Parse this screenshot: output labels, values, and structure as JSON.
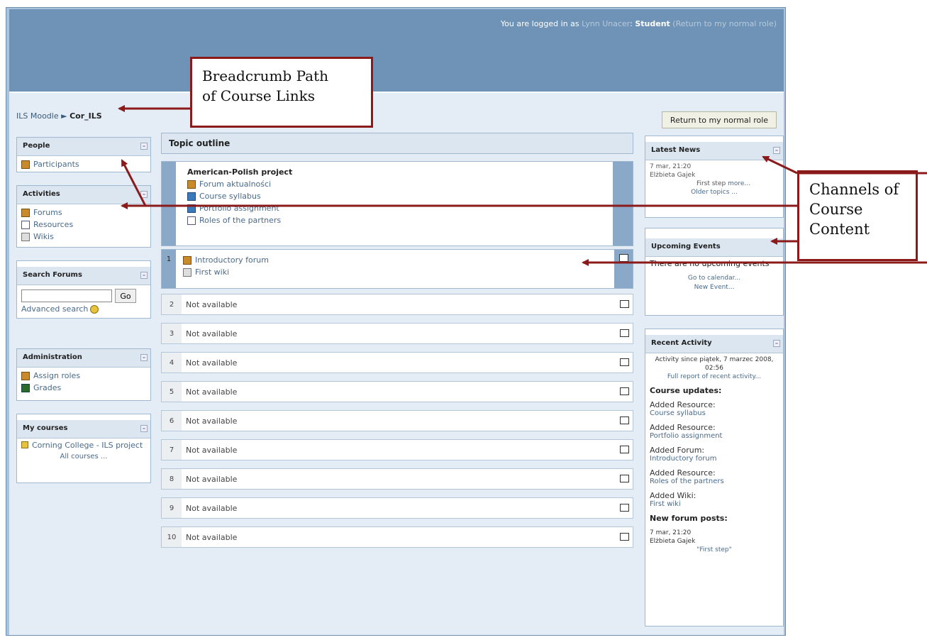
{
  "header": {
    "login_prefix": "You are logged in as",
    "user": "Lynn Unacer",
    "role": "Student",
    "return_link": "(Return to my normal role)"
  },
  "breadcrumb": {
    "home": "ILS Moodle",
    "sep": "►",
    "course": "Cor_ILS"
  },
  "return_button": "Return to my normal role",
  "left": {
    "people": {
      "title": "People",
      "items": [
        "Participants"
      ]
    },
    "activities": {
      "title": "Activities",
      "items": [
        "Forums",
        "Resources",
        "Wikis"
      ]
    },
    "search": {
      "title": "Search Forums",
      "go": "Go",
      "advanced": "Advanced search"
    },
    "admin": {
      "title": "Administration",
      "items": [
        "Assign roles",
        "Grades"
      ]
    },
    "courses": {
      "title": "My courses",
      "items": [
        "Corning College - ILS project"
      ],
      "all": "All courses ..."
    }
  },
  "center": {
    "title": "Topic outline",
    "section0": {
      "title": "American-Polish project",
      "items": [
        "Forum aktualności",
        "Course syllabus",
        "Portfolio assignment",
        "Roles of the partners"
      ]
    },
    "section1": {
      "num": "1",
      "items": [
        "Introductory forum",
        "First wiki"
      ]
    },
    "topics": [
      {
        "num": "2",
        "label": "Not available"
      },
      {
        "num": "3",
        "label": "Not available"
      },
      {
        "num": "4",
        "label": "Not available"
      },
      {
        "num": "5",
        "label": "Not available"
      },
      {
        "num": "6",
        "label": "Not available"
      },
      {
        "num": "7",
        "label": "Not available"
      },
      {
        "num": "8",
        "label": "Not available"
      },
      {
        "num": "9",
        "label": "Not available"
      },
      {
        "num": "10",
        "label": "Not available"
      }
    ]
  },
  "right": {
    "news": {
      "title": "Latest News",
      "date": "7 mar, 21:20",
      "author": "Elżbieta Gajek",
      "post": "First step",
      "more": "more...",
      "older": "Older topics ..."
    },
    "events": {
      "title": "Upcoming Events",
      "text": "There are no upcoming events",
      "calendar": "Go to calendar...",
      "new": "New Event..."
    },
    "activity": {
      "title": "Recent Activity",
      "since": "Activity since piątek, 7 marzec 2008, 02:56",
      "full": "Full report of recent activity...",
      "updates": "Course updates:",
      "entries": [
        {
          "type": "Added Resource:",
          "name": "Course syllabus"
        },
        {
          "type": "Added Resource:",
          "name": "Portfolio assignment"
        },
        {
          "type": "Added Forum:",
          "name": "Introductory forum"
        },
        {
          "type": "Added Resource:",
          "name": "Roles of the partners"
        },
        {
          "type": "Added Wiki:",
          "name": "First wiki"
        }
      ],
      "posts": "New forum posts:",
      "post_date": "7 mar, 21:20",
      "post_author": "Elżbieta Gajek",
      "post_title": "\"First step\""
    }
  },
  "annotations": {
    "breadcrumb": [
      "Breadcrumb Path",
      "of Course Links"
    ],
    "channels": [
      "Channels of",
      "Course",
      "Content"
    ]
  },
  "colors": {
    "annotation": "#8b1a1a",
    "header": "#6f93b6"
  }
}
